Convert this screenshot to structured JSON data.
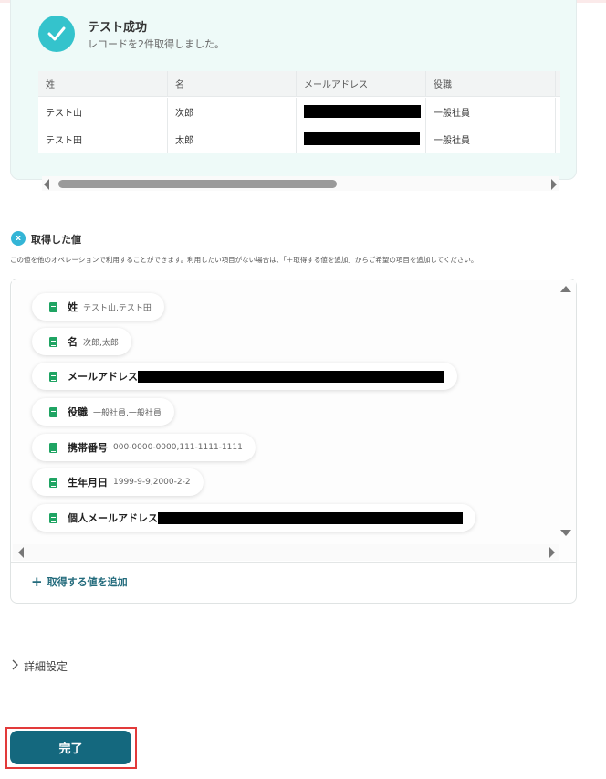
{
  "success": {
    "title": "テスト成功",
    "subtitle": "レコードを2件取得しました。"
  },
  "table": {
    "headers": [
      "姓",
      "名",
      "メールアドレス",
      "役職"
    ],
    "rows": [
      [
        "テスト山",
        "次郎",
        "[redacted]",
        "一般社員"
      ],
      [
        "テスト田",
        "太郎",
        "[redacted]",
        "一般社員"
      ]
    ]
  },
  "acquired": {
    "title": "取得した値",
    "description": "この値を他のオペレーションで利用することができます。利用したい項目がない場合は、「＋取得する値を追加」からご希望の項目を追加してください。",
    "items": [
      {
        "label": "姓",
        "value": "テスト山,テスト田"
      },
      {
        "label": "名",
        "value": "次郎,太郎"
      },
      {
        "label": "メールアドレス",
        "value": "[redacted]"
      },
      {
        "label": "役職",
        "value": "一般社員,一般社員"
      },
      {
        "label": "携帯番号",
        "value": "000-0000-0000,111-1111-1111"
      },
      {
        "label": "生年月日",
        "value": "1999-9-9,2000-2-2"
      },
      {
        "label": "個人メールアドレス",
        "value": "[redacted]"
      }
    ],
    "add_label": "取得する値を追加"
  },
  "details": {
    "label": "詳細設定"
  },
  "done_button": {
    "label": "完了"
  },
  "colors": {
    "accent": "#14687e",
    "success": "#34c3cc",
    "sheet": "#1fa463",
    "highlight": "#e23a3a"
  }
}
